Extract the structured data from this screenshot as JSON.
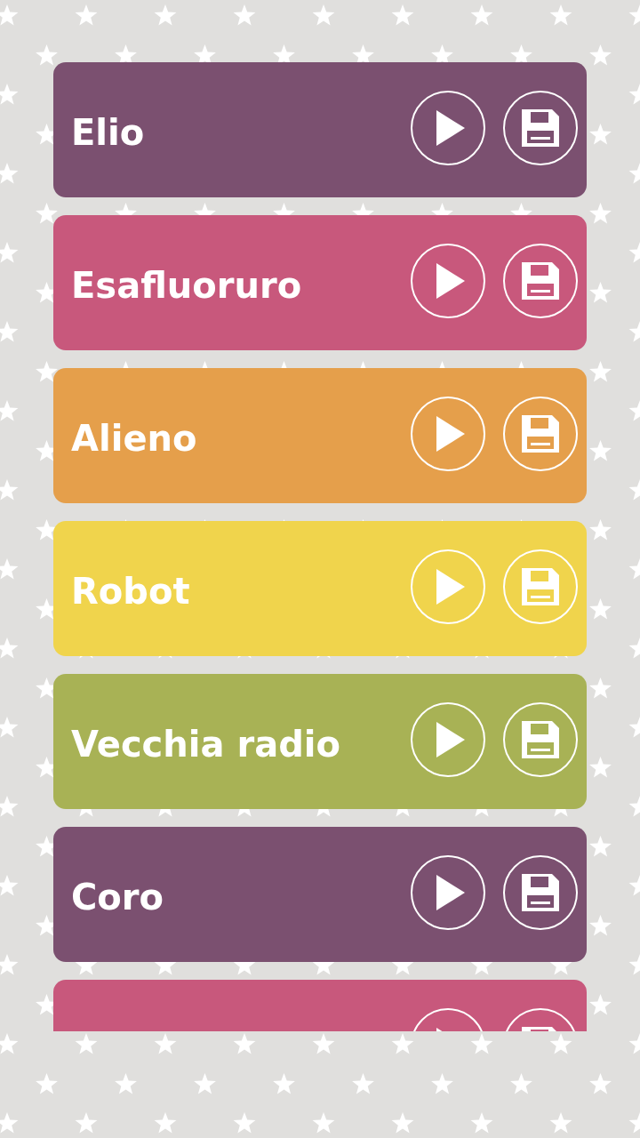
{
  "sounds": [
    {
      "name": "Elio",
      "color": "#7b5070"
    },
    {
      "name": "Esafluoruro",
      "color": "#c8587c"
    },
    {
      "name": "Alieno",
      "color": "#e59f4b"
    },
    {
      "name": "Robot",
      "color": "#f0d44c"
    },
    {
      "name": "Vecchia radio",
      "color": "#a8b255"
    },
    {
      "name": "Coro",
      "color": "#7b5070"
    },
    {
      "color": "#c8587c"
    }
  ]
}
